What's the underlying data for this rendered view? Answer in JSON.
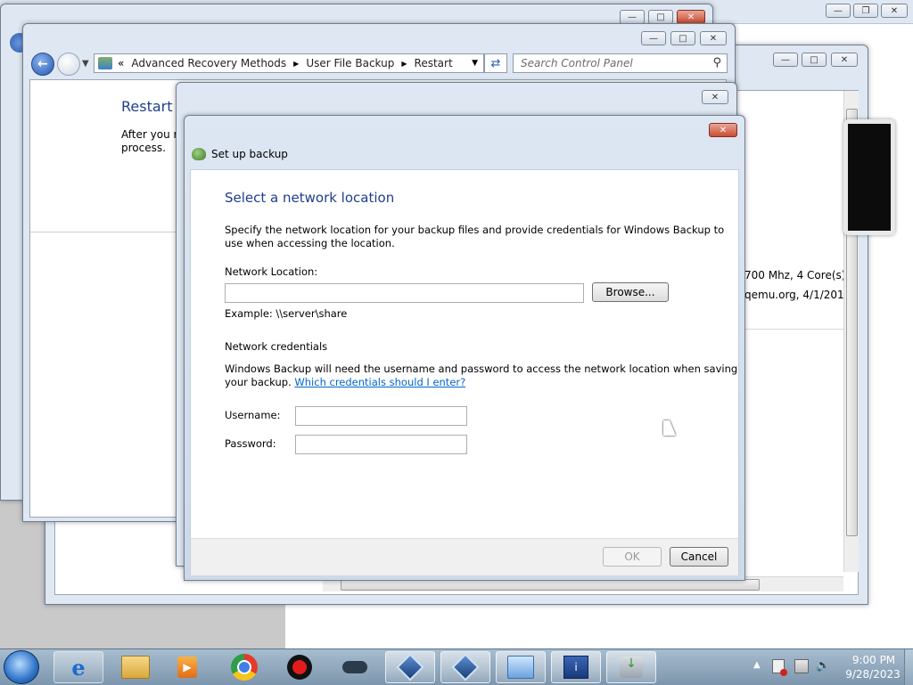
{
  "back_window": {
    "restart_title_fragment": "Restart y",
    "restart_text_line1": "After you re",
    "restart_text_line2": "process.",
    "nav": {
      "breadcrumb_prefix": "«",
      "crumbs": [
        "Advanced Recovery Methods",
        "User File Backup",
        "Restart"
      ],
      "search_placeholder": "Search Control Panel"
    }
  },
  "right_window": {
    "cpu_text": "700 Mhz, 4 Core(s)",
    "bios_text": "qemu.org, 4/1/2014"
  },
  "dialog": {
    "title": "Set up backup",
    "heading": "Select a network location",
    "description_line1": "Specify the network location for your backup files and provide credentials for Windows Backup to",
    "description_line2": "use when accessing the location.",
    "network_location_label": "Network Location:",
    "network_location_value": "",
    "browse_label": "Browse...",
    "example_text": "Example: \\\\server\\share",
    "credentials_heading": "Network credentials",
    "credentials_text_line1": "Windows Backup will need the username and password to access the network location when saving",
    "credentials_text_line2": "your backup.",
    "credentials_link": "Which credentials should I enter?",
    "username_label": "Username:",
    "username_value": "",
    "password_label": "Password:",
    "password_value": "",
    "ok_label": "OK",
    "cancel_label": "Cancel"
  },
  "taskbar": {
    "time": "9:00 PM",
    "date": "9/28/2023",
    "apps": [
      "internet-explorer-icon",
      "file-explorer-icon",
      "media-player-icon",
      "chrome-icon",
      "record-icon",
      "game-controller-icon",
      "virtualbox-icon",
      "virtualbox-icon",
      "control-panel-icon",
      "system-info-icon",
      "backup-restore-icon"
    ]
  },
  "colors": {
    "heading_blue": "#1e3e8c",
    "link_blue": "#0066cc",
    "close_red": "#c84d32",
    "taskbar": "#8aa3b8"
  }
}
